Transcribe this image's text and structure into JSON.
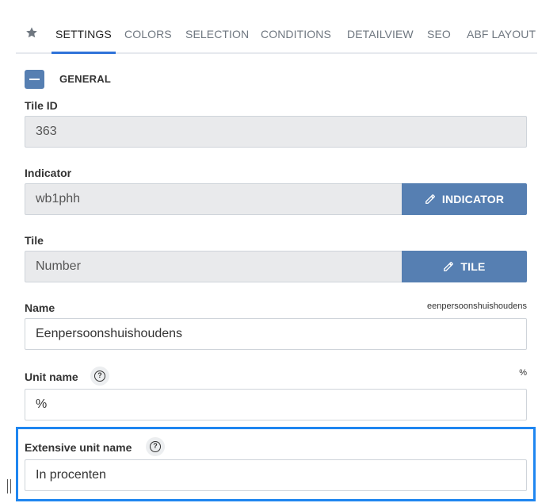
{
  "tabs": {
    "star_icon": "star-icon",
    "items": [
      "SETTINGS",
      "COLORS",
      "SELECTION",
      "CONDITIONS",
      "DETAILVIEW",
      "SEO",
      "ABF LAYOUT"
    ],
    "active": "SETTINGS"
  },
  "section": {
    "title": "GENERAL"
  },
  "fields": {
    "tile_id": {
      "label": "Tile ID",
      "value": "363"
    },
    "indicator": {
      "label": "Indicator",
      "value": "wb1phh",
      "button": "INDICATOR"
    },
    "tile": {
      "label": "Tile",
      "value": "Number",
      "button": "TILE"
    },
    "name": {
      "label": "Name",
      "hint": "eenpersoonshuishoudens",
      "value": "Eenpersoonshuishoudens"
    },
    "unit_name": {
      "label": "Unit name",
      "hint": "%",
      "value": "%"
    },
    "extensive_unit_name": {
      "label": "Extensive unit name",
      "value": "In procenten"
    }
  },
  "colors": {
    "accent": "#567fb2",
    "tab_underline": "#2f73d9",
    "highlight": "#1f86f0"
  }
}
